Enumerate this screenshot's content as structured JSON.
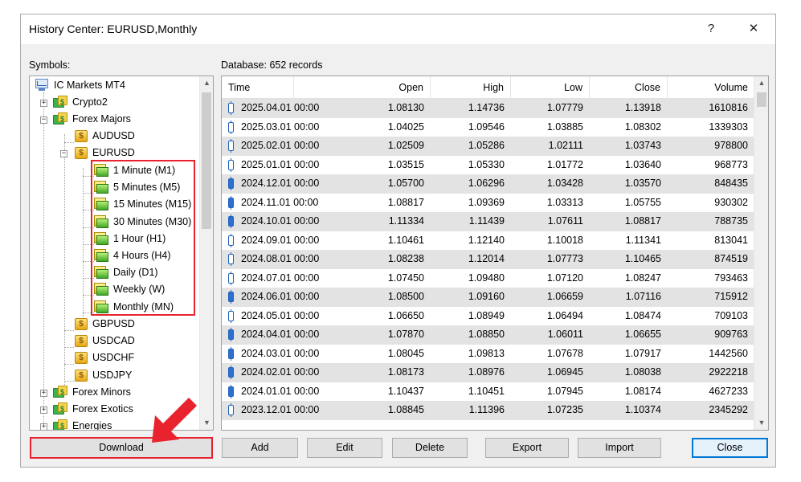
{
  "window": {
    "title": "History Center: EURUSD,Monthly",
    "help_label": "?",
    "close_label": "✕"
  },
  "symbols_label": "Symbols:",
  "database_label": "Database: 652 records",
  "tree": {
    "root": "IC Markets MT4",
    "groups": [
      {
        "label": "Crypto2",
        "expanded": false
      },
      {
        "label": "Forex Majors",
        "expanded": true
      },
      {
        "label": "Forex Minors",
        "expanded": false
      },
      {
        "label": "Forex Exotics",
        "expanded": false
      },
      {
        "label": "Energies",
        "expanded": false
      }
    ],
    "symbols": [
      "AUDUSD",
      "EURUSD",
      "GBPUSD",
      "USDCAD",
      "USDCHF",
      "USDJPY"
    ],
    "timeframes": [
      "1 Minute (M1)",
      "5 Minutes (M5)",
      "15 Minutes (M15)",
      "30 Minutes (M30)",
      "1 Hour (H1)",
      "4 Hours (H4)",
      "Daily (D1)",
      "Weekly (W)",
      "Monthly (MN)"
    ]
  },
  "grid": {
    "columns": [
      "Time",
      "Open",
      "High",
      "Low",
      "Close",
      "Volume"
    ],
    "rows": [
      {
        "time": "2025.04.01 00:00",
        "open": "1.08130",
        "high": "1.14736",
        "low": "1.07779",
        "close": "1.13918",
        "volume": "1610816",
        "bull": true
      },
      {
        "time": "2025.03.01 00:00",
        "open": "1.04025",
        "high": "1.09546",
        "low": "1.03885",
        "close": "1.08302",
        "volume": "1339303",
        "bull": true
      },
      {
        "time": "2025.02.01 00:00",
        "open": "1.02509",
        "high": "1.05286",
        "low": "1.02111",
        "close": "1.03743",
        "volume": "978800",
        "bull": true
      },
      {
        "time": "2025.01.01 00:00",
        "open": "1.03515",
        "high": "1.05330",
        "low": "1.01772",
        "close": "1.03640",
        "volume": "968773",
        "bull": true
      },
      {
        "time": "2024.12.01 00:00",
        "open": "1.05700",
        "high": "1.06296",
        "low": "1.03428",
        "close": "1.03570",
        "volume": "848435",
        "bull": false
      },
      {
        "time": "2024.11.01 00:00",
        "open": "1.08817",
        "high": "1.09369",
        "low": "1.03313",
        "close": "1.05755",
        "volume": "930302",
        "bull": false
      },
      {
        "time": "2024.10.01 00:00",
        "open": "1.11334",
        "high": "1.11439",
        "low": "1.07611",
        "close": "1.08817",
        "volume": "788735",
        "bull": false
      },
      {
        "time": "2024.09.01 00:00",
        "open": "1.10461",
        "high": "1.12140",
        "low": "1.10018",
        "close": "1.11341",
        "volume": "813041",
        "bull": true
      },
      {
        "time": "2024.08.01 00:00",
        "open": "1.08238",
        "high": "1.12014",
        "low": "1.07773",
        "close": "1.10465",
        "volume": "874519",
        "bull": true
      },
      {
        "time": "2024.07.01 00:00",
        "open": "1.07450",
        "high": "1.09480",
        "low": "1.07120",
        "close": "1.08247",
        "volume": "793463",
        "bull": true
      },
      {
        "time": "2024.06.01 00:00",
        "open": "1.08500",
        "high": "1.09160",
        "low": "1.06659",
        "close": "1.07116",
        "volume": "715912",
        "bull": false
      },
      {
        "time": "2024.05.01 00:00",
        "open": "1.06650",
        "high": "1.08949",
        "low": "1.06494",
        "close": "1.08474",
        "volume": "709103",
        "bull": true
      },
      {
        "time": "2024.04.01 00:00",
        "open": "1.07870",
        "high": "1.08850",
        "low": "1.06011",
        "close": "1.06655",
        "volume": "909763",
        "bull": false
      },
      {
        "time": "2024.03.01 00:00",
        "open": "1.08045",
        "high": "1.09813",
        "low": "1.07678",
        "close": "1.07917",
        "volume": "1442560",
        "bull": false
      },
      {
        "time": "2024.02.01 00:00",
        "open": "1.08173",
        "high": "1.08976",
        "low": "1.06945",
        "close": "1.08038",
        "volume": "2922218",
        "bull": false
      },
      {
        "time": "2024.01.01 00:00",
        "open": "1.10437",
        "high": "1.10451",
        "low": "1.07945",
        "close": "1.08174",
        "volume": "4627233",
        "bull": false
      },
      {
        "time": "2023.12.01 00:00",
        "open": "1.08845",
        "high": "1.11396",
        "low": "1.07235",
        "close": "1.10374",
        "volume": "2345292",
        "bull": true
      }
    ]
  },
  "buttons": {
    "download": "Download",
    "add": "Add",
    "edit": "Edit",
    "delete": "Delete",
    "export": "Export",
    "import": "Import",
    "close": "Close"
  },
  "colors": {
    "highlight": "#e8232d",
    "accent": "#0078d7"
  }
}
